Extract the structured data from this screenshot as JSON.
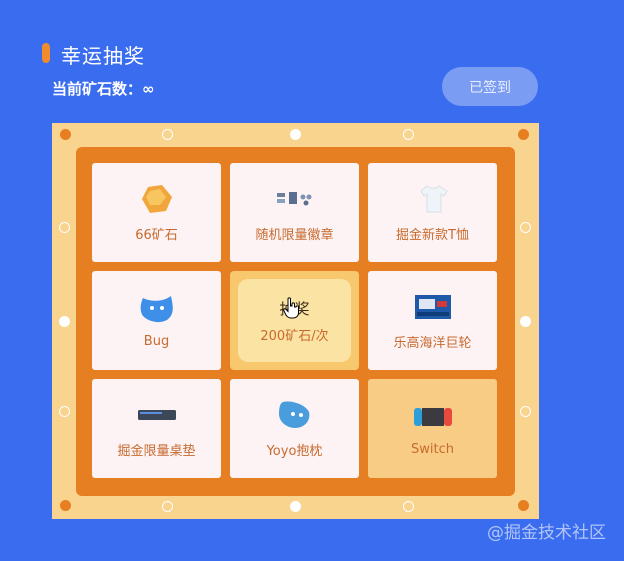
{
  "header": {
    "title": "幸运抽奖",
    "ore_label": "当前矿石数：∞"
  },
  "sign_button": {
    "label": "已签到"
  },
  "prizes": [
    {
      "label": "66矿石",
      "icon": "ore-icon"
    },
    {
      "label": "随机限量徽章",
      "icon": "badge-icon"
    },
    {
      "label": "掘金新款T恤",
      "icon": "tshirt-icon"
    },
    {
      "label": "Bug",
      "icon": "bug-plush-icon"
    },
    {
      "label": "乐高海洋巨轮",
      "icon": "lego-ship-icon"
    },
    {
      "label": "掘金限量桌垫",
      "icon": "desk-mat-icon"
    },
    {
      "label": "Yoyo抱枕",
      "icon": "pillow-icon"
    },
    {
      "label": "Switch",
      "icon": "switch-console-icon"
    }
  ],
  "draw": {
    "label": "抽奖",
    "cost": "200矿石/次"
  },
  "watermark": "@掘金技术社区",
  "colors": {
    "background": "#3a6cef",
    "accent": "#f28b2c",
    "frame": "#e67e22",
    "board": "#f9d48e"
  }
}
